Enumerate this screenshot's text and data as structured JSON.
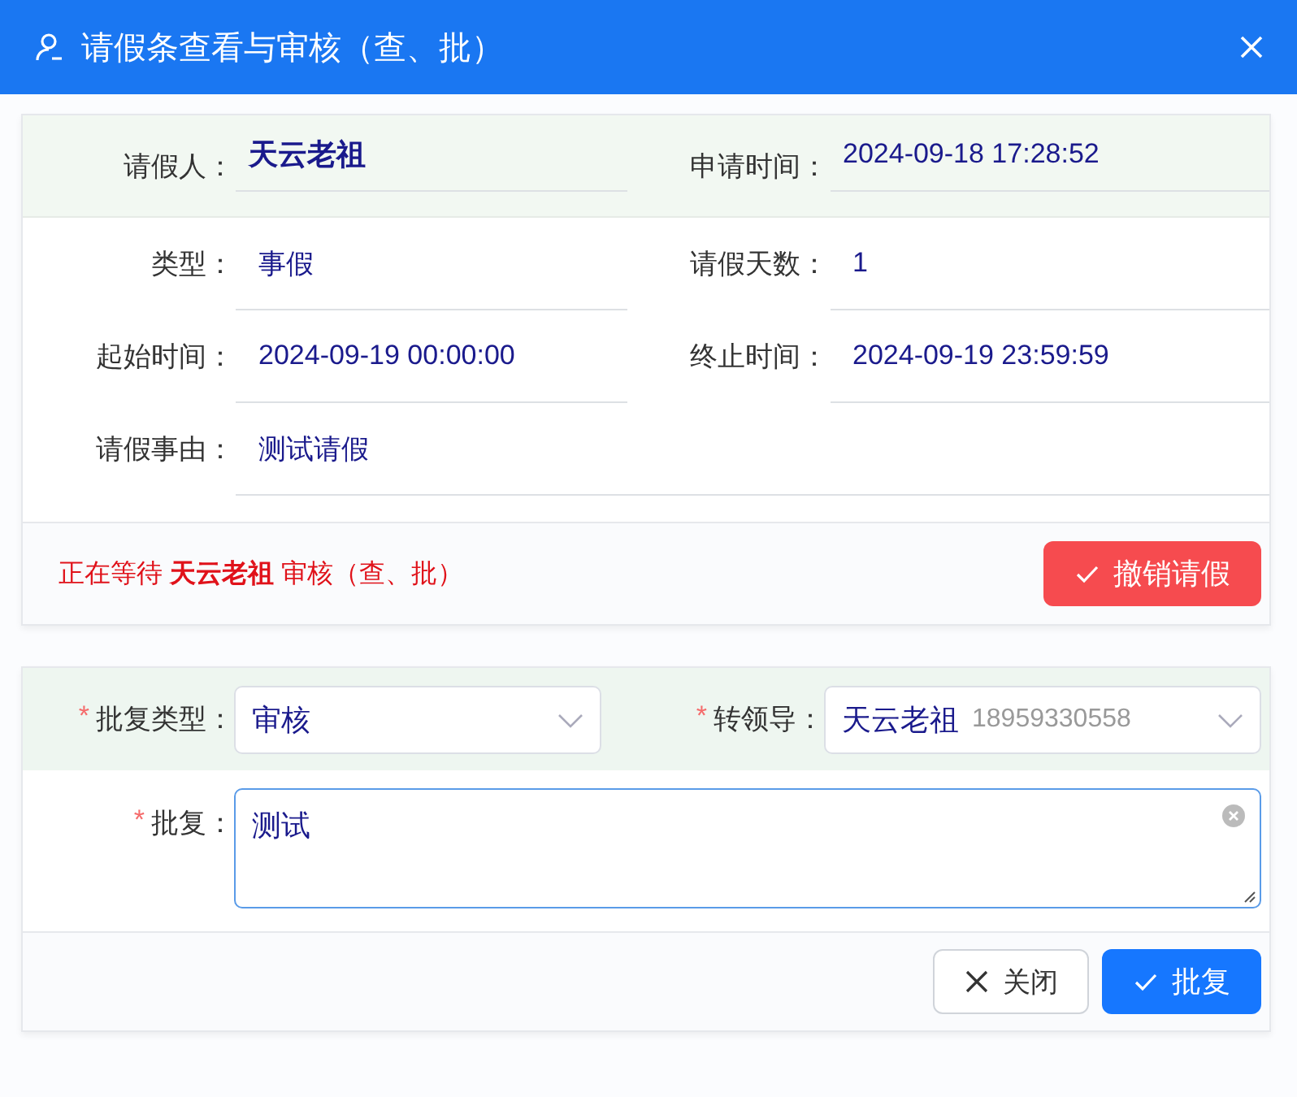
{
  "dialog": {
    "title": "请假条查看与审核（查、批）"
  },
  "details": {
    "fields": [
      {
        "label": "请假人：",
        "value": "天云老祖",
        "kind": "name",
        "wide": false
      },
      {
        "label": "申请时间：",
        "value": "2024-09-18 17:28:52",
        "kind": "text",
        "wide": false
      },
      {
        "label": "类型：",
        "value": "事假",
        "kind": "text",
        "wide": false
      },
      {
        "label": "请假天数：",
        "value": "1",
        "kind": "text",
        "wide": false
      },
      {
        "label": "起始时间：",
        "value": "2024-09-19 00:00:00",
        "kind": "text",
        "wide": false
      },
      {
        "label": "终止时间：",
        "value": "2024-09-19 23:59:59",
        "kind": "text",
        "wide": false
      },
      {
        "label": "请假事由：",
        "value": "测试请假",
        "kind": "text",
        "wide": true
      }
    ],
    "status": "正在等待 **天云老祖** 审核（查、批）",
    "cancel_button": "撤销请假"
  },
  "approval": {
    "selects": [
      {
        "mark": "*",
        "label": "批复类型：",
        "value": "审核"
      },
      {
        "mark": "*",
        "label": "转领导：",
        "value": "天云老祖",
        "hint": "18959330558"
      }
    ],
    "reply": {
      "mark": "*",
      "label": "批复：",
      "value": "测试"
    },
    "buttons": [
      {
        "label": "关闭",
        "kind": "secondary"
      },
      {
        "label": "批复",
        "kind": "primary"
      }
    ]
  }
}
